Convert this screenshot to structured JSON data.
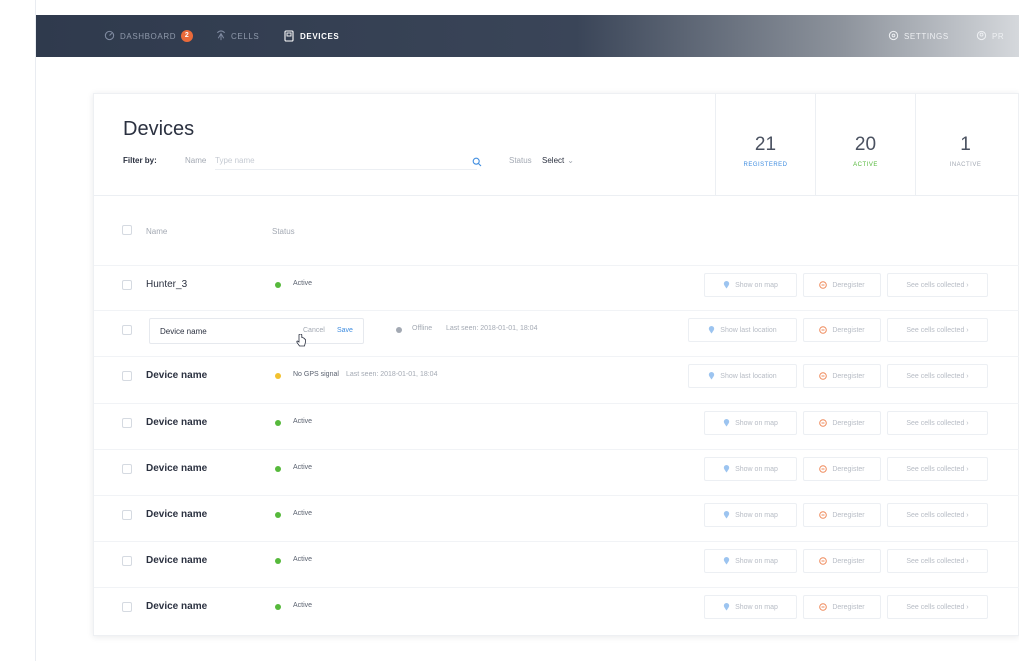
{
  "nav": {
    "items": [
      {
        "label": "DASHBOARD",
        "icon": "dashboard-icon",
        "badge": "2"
      },
      {
        "label": "CELLS",
        "icon": "cells-icon"
      },
      {
        "label": "DEVICES",
        "icon": "devices-icon",
        "active": true
      }
    ],
    "right": [
      {
        "label": "SETTINGS",
        "icon": "gear-icon"
      },
      {
        "label": "PR",
        "icon": "profile-icon"
      }
    ]
  },
  "header": {
    "title": "Devices",
    "filter_label": "Filter by:",
    "name_label": "Name",
    "name_placeholder": "Type name",
    "status_label": "Status",
    "status_value": "Select"
  },
  "stats": [
    {
      "value": "21",
      "label": "REGISTERED",
      "color": "#3f8de0"
    },
    {
      "value": "20",
      "label": "ACTIVE",
      "color": "#56b93b"
    },
    {
      "value": "1",
      "label": "INACTIVE",
      "color": "#a3a9b3"
    }
  ],
  "table": {
    "columns": {
      "name": "Name",
      "status": "Status"
    },
    "edit_row": {
      "input_value": "Device name",
      "cancel_label": "Cancel",
      "save_label": "Save",
      "status": "Offline",
      "last_seen": "Last seen: 2018-01-01, 18:04",
      "location_label": "Show last location",
      "deregister_label": "Deregister",
      "cells_label": "See cells collected"
    },
    "rows": [
      {
        "name": "Hunter_3",
        "status": "Active",
        "last_seen": "",
        "location_label": "Show on map",
        "deregister_label": "Deregister",
        "cells_label": "See cells collected"
      },
      {
        "name": "Device name",
        "status": "No GPS signal",
        "last_seen": "Last seen: 2018-01-01, 18:04",
        "location_label": "Show last location",
        "deregister_label": "Deregister",
        "cells_label": "See cells collected"
      },
      {
        "name": "Device name",
        "status": "Active",
        "last_seen": "",
        "location_label": "Show on map",
        "deregister_label": "Deregister",
        "cells_label": "See cells collected"
      },
      {
        "name": "Device name",
        "status": "Active",
        "last_seen": "",
        "location_label": "Show on map",
        "deregister_label": "Deregister",
        "cells_label": "See cells collected"
      },
      {
        "name": "Device name",
        "status": "Active",
        "last_seen": "",
        "location_label": "Show on map",
        "deregister_label": "Deregister",
        "cells_label": "See cells collected"
      },
      {
        "name": "Device name",
        "status": "Active",
        "last_seen": "",
        "location_label": "Show on map",
        "deregister_label": "Deregister",
        "cells_label": "See cells collected"
      },
      {
        "name": "Device name",
        "status": "Active",
        "last_seen": "",
        "location_label": "Show on map",
        "deregister_label": "Deregister",
        "cells_label": "See cells collected"
      }
    ]
  },
  "colors": {
    "active": "#56b93b",
    "offline": "#a3a9b3",
    "no_gps": "#f2c12e",
    "accent": "#3f8de0",
    "deregister": "#ef8a5b"
  }
}
